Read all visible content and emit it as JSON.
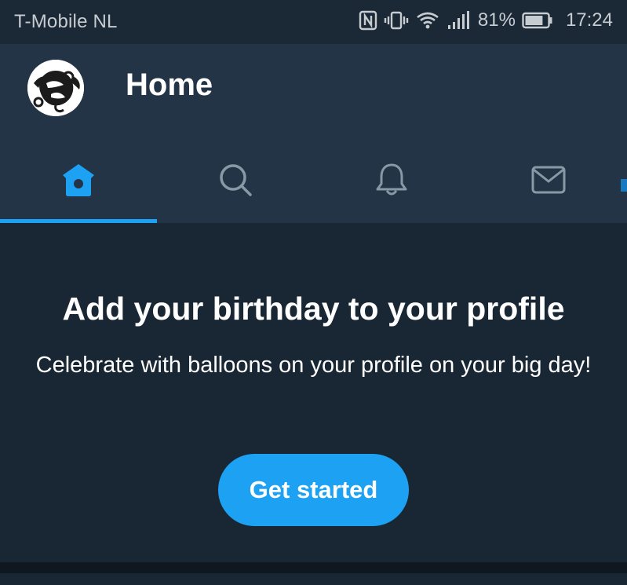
{
  "status_bar": {
    "carrier": "T-Mobile  NL",
    "battery_percent": "81%",
    "time": "17:24",
    "icons": [
      "nfc-icon",
      "vibrate-icon",
      "wifi-icon",
      "signal-icon",
      "battery-icon"
    ],
    "battery_level": 0.81
  },
  "header": {
    "title": "Home",
    "avatar": "profile-avatar"
  },
  "tabs": [
    {
      "name": "home",
      "icon": "home-icon",
      "selected": true
    },
    {
      "name": "search",
      "icon": "search-icon",
      "selected": false
    },
    {
      "name": "notifications",
      "icon": "bell-icon",
      "selected": false
    },
    {
      "name": "messages",
      "icon": "mail-icon",
      "selected": false
    }
  ],
  "prompt": {
    "title": "Add your birthday to your profile",
    "subtitle": "Celebrate with balloons on your profile on your big day!",
    "button_label": "Get started"
  },
  "colors": {
    "accent": "#1da1f2",
    "header_bg": "#243447",
    "card_bg": "#192734",
    "icon_inactive": "#8899a6"
  }
}
